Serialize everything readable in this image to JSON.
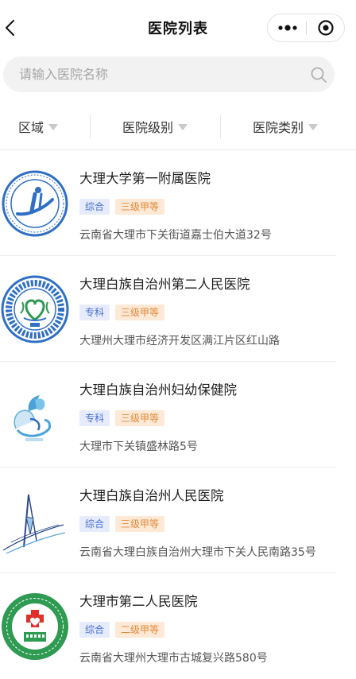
{
  "header": {
    "title": "医院列表"
  },
  "search": {
    "placeholder": "请输入医院名称",
    "value": ""
  },
  "filters": [
    {
      "label": "区域"
    },
    {
      "label": "医院级别"
    },
    {
      "label": "医院类别"
    }
  ],
  "hospitals": [
    {
      "name": "大理大学第一附属医院",
      "type": "综合",
      "grade": "三级甲等",
      "address": "云南省大理市下关街道嘉士伯大道32号"
    },
    {
      "name": "大理白族自治州第二人民医院",
      "type": "专科",
      "grade": "三级甲等",
      "address": "大理州大理市经济开发区满江片区红山路"
    },
    {
      "name": "大理白族自治州妇幼保健院",
      "type": "专科",
      "grade": "三级甲等",
      "address": "大理市下关镇盛林路5号"
    },
    {
      "name": "大理白族自治州人民医院",
      "type": "综合",
      "grade": "三级甲等",
      "address": "云南省大理白族自治州大理市下关人民南路35号"
    },
    {
      "name": "大理市第二人民医院",
      "type": "综合",
      "grade": "二级甲等",
      "address": "云南省大理州大理市古城复兴路580号"
    }
  ],
  "colors": {
    "tag_type_bg": "#e6ecfb",
    "tag_type_text": "#4a6fd0",
    "tag_grade_bg": "#fde9d6",
    "tag_grade_text": "#e08b3c",
    "hospital_logo_blue": "#2f6fc4",
    "hospital_logo_green": "#2e9a52"
  }
}
